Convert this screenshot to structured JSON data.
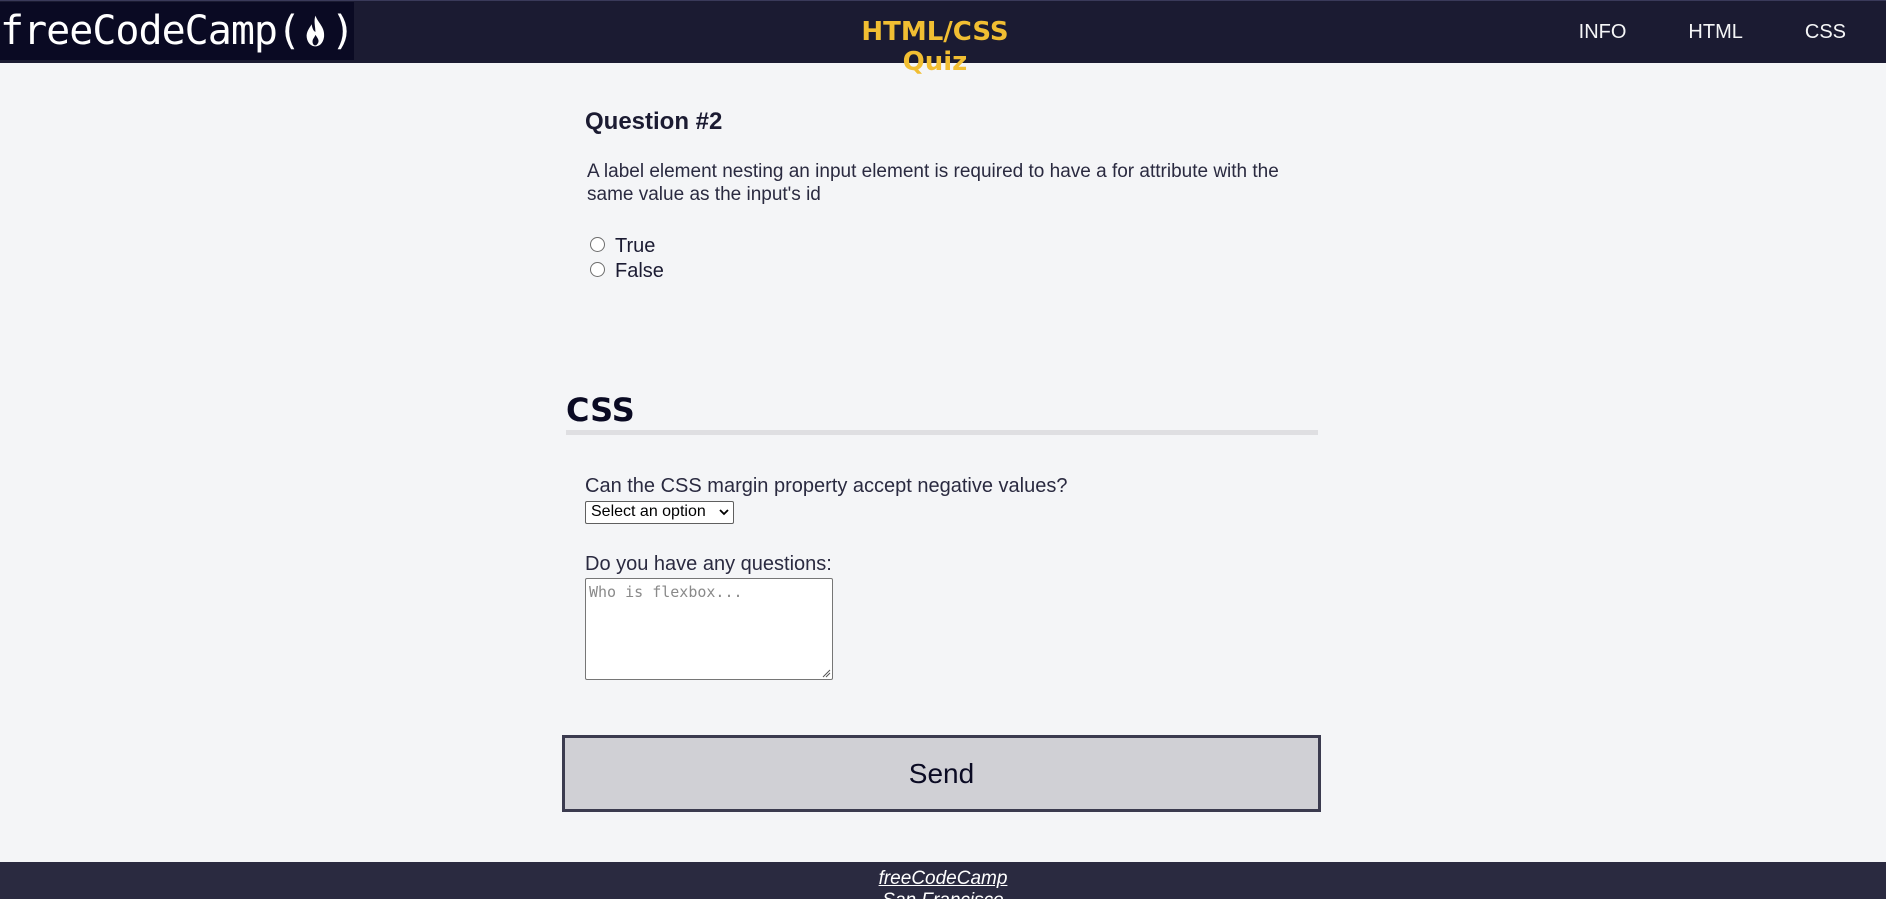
{
  "header": {
    "logo_text": "freeCodeCamp(",
    "logo_text_end": ")",
    "title": "HTML/CSS Quiz",
    "nav": [
      {
        "label": "INFO"
      },
      {
        "label": "HTML"
      },
      {
        "label": "CSS"
      }
    ]
  },
  "question2": {
    "title": "Question #2",
    "text": "A label element nesting an input element is required to have a for attribute with the same value as the input's id",
    "options": [
      {
        "label": "True",
        "selected": false
      },
      {
        "label": "False",
        "selected": false
      }
    ]
  },
  "css_section": {
    "heading": "CSS",
    "margin_question": "Can the CSS margin property accept negative values?",
    "select_value": "Select an option",
    "questions_label": "Do you have any questions:",
    "textarea_placeholder": "Who is flexbox..."
  },
  "send_label": "Send",
  "footer": {
    "link": "freeCodeCamp",
    "city": "San Francisco"
  },
  "colors": {
    "topbar": "#1b1b32",
    "title_accent": "#f1be32",
    "page_bg": "#f4f5f7",
    "button_bg": "#d0d0d5",
    "footer_bg": "#2a2a40"
  }
}
